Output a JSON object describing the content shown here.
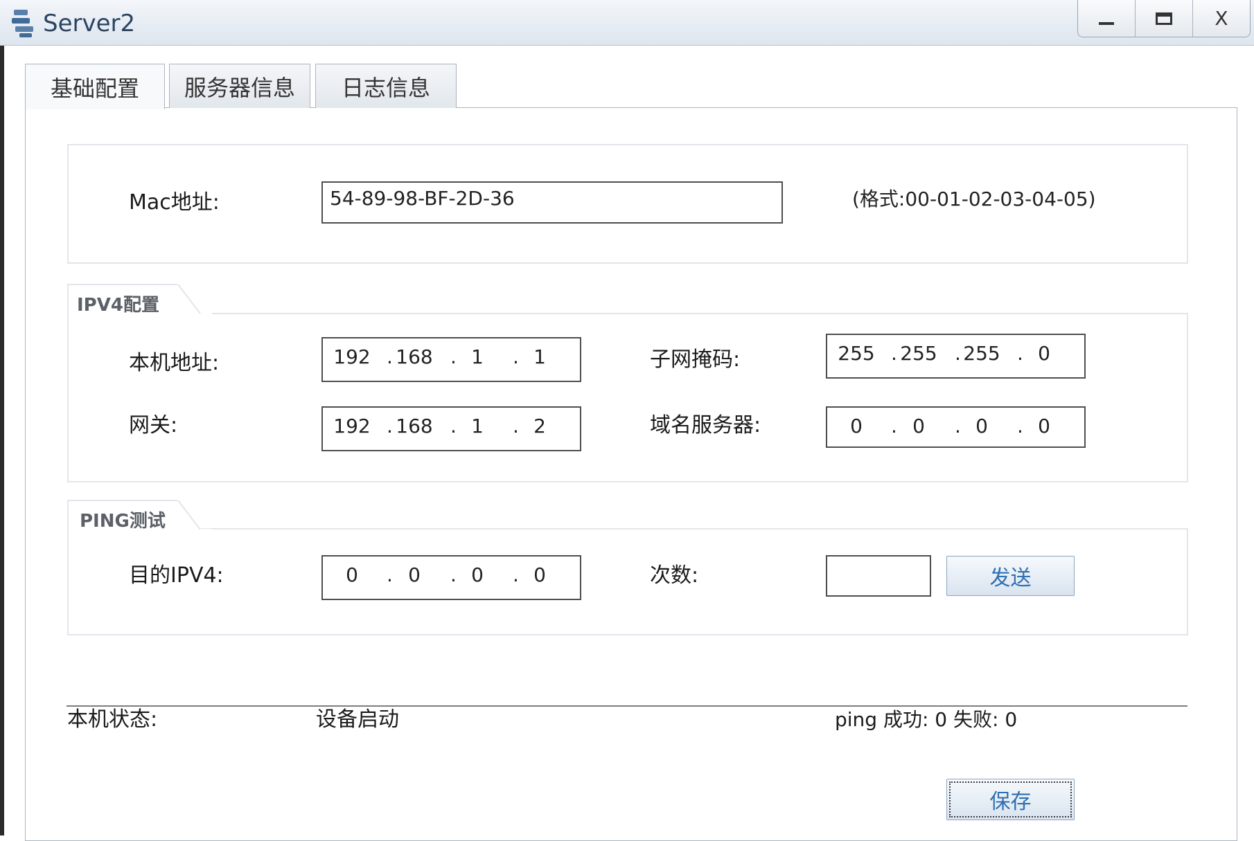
{
  "window": {
    "title": "Server2",
    "minimize": "_",
    "maximize": "□",
    "close": "X"
  },
  "tabs": [
    {
      "label": "基础配置",
      "active": true
    },
    {
      "label": "服务器信息",
      "active": false
    },
    {
      "label": "日志信息",
      "active": false
    }
  ],
  "mac": {
    "label": "Mac地址:",
    "value": "54-89-98-BF-2D-36",
    "hint": "(格式:00-01-02-03-04-05)"
  },
  "ipv4": {
    "legend": "IPV4配置",
    "host_label": "本机地址:",
    "host": [
      "192",
      "168",
      "1",
      "1"
    ],
    "mask_label": "子网掩码:",
    "mask": [
      "255",
      "255",
      "255",
      "0"
    ],
    "gateway_label": "网关:",
    "gateway": [
      "192",
      "168",
      "1",
      "2"
    ],
    "dns_label": "域名服务器:",
    "dns": [
      "0",
      "0",
      "0",
      "0"
    ]
  },
  "ping": {
    "legend": "PING测试",
    "dest_label": "目的IPV4:",
    "dest": [
      "0",
      "0",
      "0",
      "0"
    ],
    "count_label": "次数:",
    "count_value": "",
    "send_label": "发送"
  },
  "status": {
    "label": "本机状态:",
    "value": "设备启动",
    "ping_result": "ping 成功: 0 失败: 0"
  },
  "save_label": "保存",
  "icons": {
    "app": "server-app-icon"
  },
  "colors": {
    "title_text": "#2b4461",
    "button_text": "#2f6fb0",
    "field_border": "#4d4d4d"
  }
}
